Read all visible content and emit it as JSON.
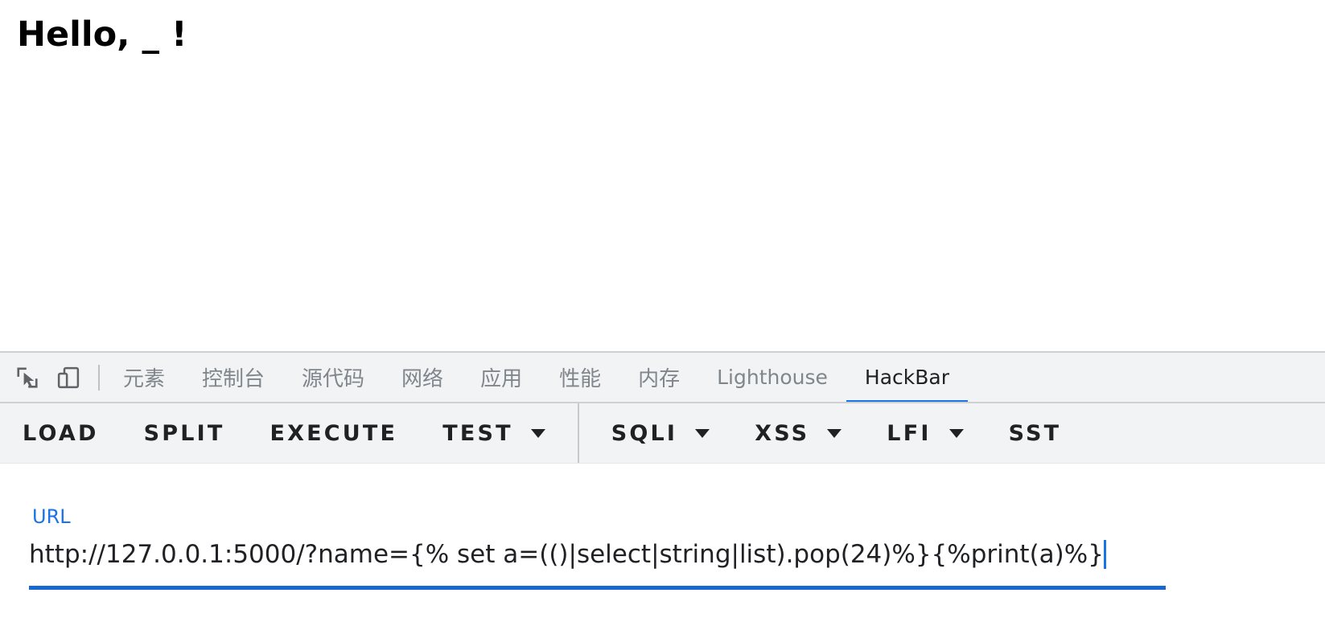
{
  "page": {
    "heading": "Hello, _ !"
  },
  "devtools": {
    "icons": [
      {
        "name": "inspect-element-icon",
        "label": "inspect-element-icon"
      },
      {
        "name": "device-toolbar-icon",
        "label": "device-toolbar-icon"
      }
    ],
    "tabs": [
      {
        "label": "元素",
        "active": false,
        "cjk": true
      },
      {
        "label": "控制台",
        "active": false,
        "cjk": true
      },
      {
        "label": "源代码",
        "active": false,
        "cjk": true
      },
      {
        "label": "网络",
        "active": false,
        "cjk": true
      },
      {
        "label": "应用",
        "active": false,
        "cjk": true
      },
      {
        "label": "性能",
        "active": false,
        "cjk": true
      },
      {
        "label": "内存",
        "active": false,
        "cjk": true
      },
      {
        "label": "Lighthouse",
        "active": false,
        "cjk": false
      },
      {
        "label": "HackBar",
        "active": true,
        "cjk": false
      }
    ],
    "active_tab": "HackBar",
    "accent_color": "#1a73e8"
  },
  "hackbar": {
    "actions": [
      {
        "label": "LOAD",
        "has_dropdown": false
      },
      {
        "label": "SPLIT",
        "has_dropdown": false
      },
      {
        "label": "EXECUTE",
        "has_dropdown": false
      },
      {
        "label": "TEST",
        "has_dropdown": true
      }
    ],
    "payload_menus": [
      {
        "label": "SQLI",
        "has_dropdown": true
      },
      {
        "label": "XSS",
        "has_dropdown": true
      },
      {
        "label": "LFI",
        "has_dropdown": true
      },
      {
        "label": "SST",
        "has_dropdown": true
      }
    ],
    "url_field": {
      "label": "URL",
      "value": "http://127.0.0.1:5000/?name={% set a=(()|select|string|list).pop(24)%}{%print(a)%}",
      "placeholder": "URL",
      "focused": true,
      "label_color": "#1a73e8",
      "underline_color": "#1967d2"
    }
  }
}
